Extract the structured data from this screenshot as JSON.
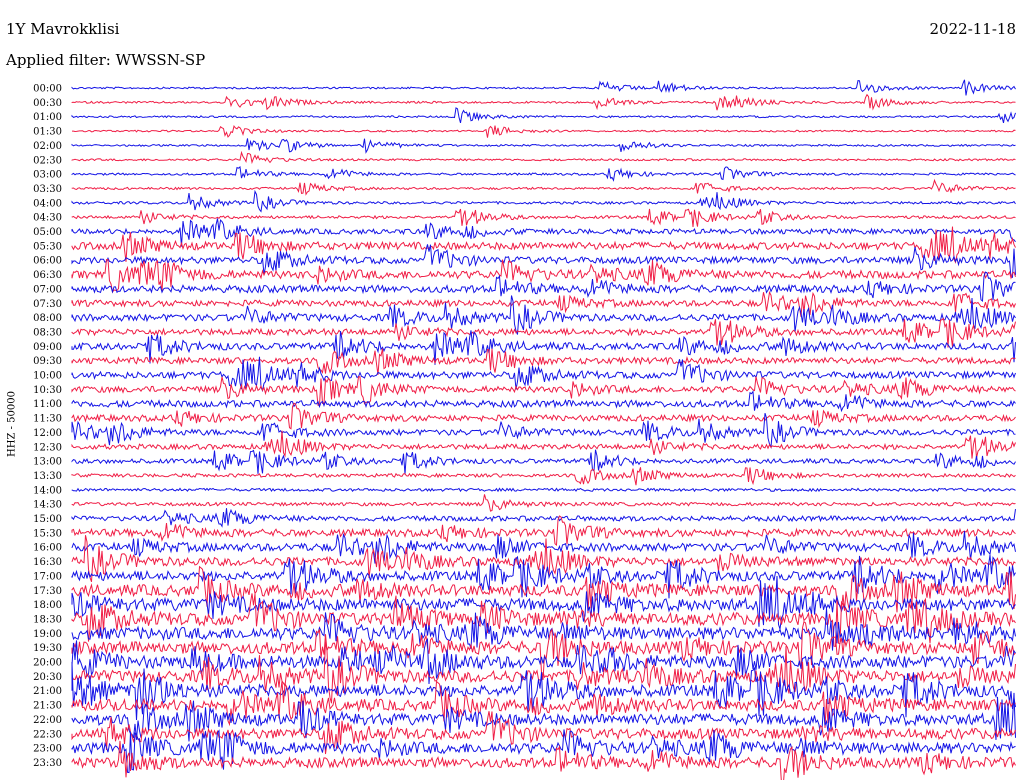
{
  "header": {
    "station": "1Y Mavrokklisi",
    "date": "2022-11-18",
    "filter": "Applied filter: WWSSN-SP"
  },
  "chart_data": {
    "type": "line",
    "title": "1Y Mavrokklisi",
    "ylabel": "HHZ - 50000",
    "xlabel": "",
    "row_labels": [
      "00:00",
      "00:30",
      "01:00",
      "01:30",
      "02:00",
      "02:30",
      "03:00",
      "03:30",
      "04:00",
      "04:30",
      "05:00",
      "05:30",
      "06:00",
      "06:30",
      "07:00",
      "07:30",
      "08:00",
      "08:30",
      "09:00",
      "09:30",
      "10:00",
      "10:30",
      "11:00",
      "11:30",
      "12:00",
      "12:30",
      "13:00",
      "13:30",
      "14:00",
      "14:30",
      "15:00",
      "15:30",
      "16:00",
      "16:30",
      "17:00",
      "17:30",
      "18:00",
      "18:30",
      "19:00",
      "19:30",
      "20:00",
      "20:30",
      "21:00",
      "21:30",
      "22:00",
      "22:30",
      "23:00",
      "23:30"
    ],
    "series_colors": [
      "#1414e6",
      "#f01e46"
    ],
    "row_activity": [
      0.05,
      0.07,
      0.06,
      0.04,
      0.05,
      0.07,
      0.08,
      0.09,
      0.12,
      0.15,
      0.35,
      0.55,
      0.5,
      0.6,
      0.55,
      0.45,
      0.5,
      0.45,
      0.5,
      0.45,
      0.5,
      0.45,
      0.5,
      0.45,
      0.4,
      0.35,
      0.3,
      0.2,
      0.15,
      0.2,
      0.35,
      0.55,
      0.6,
      0.65,
      0.75,
      0.9,
      1.0,
      1.0,
      1.0,
      1.0,
      1.0,
      0.95,
      0.95,
      0.9,
      0.9,
      0.85,
      0.85,
      0.8
    ]
  }
}
